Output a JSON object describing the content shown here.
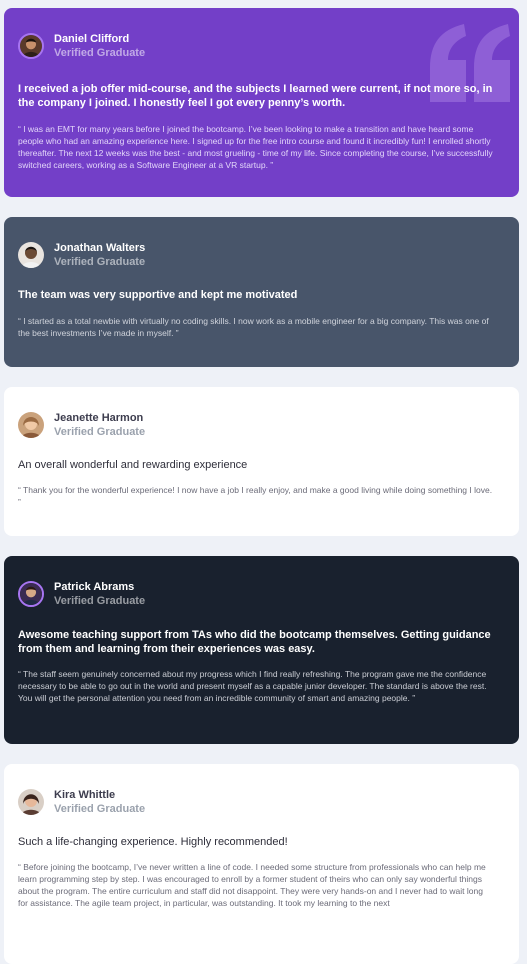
{
  "testimonials": [
    {
      "name": "Daniel Clifford",
      "role": "Verified Graduate",
      "headline": "I received a job offer mid-course, and the subjects I learned were current, if not more so, in the company I joined. I honestly feel I got every penny’s worth.",
      "quote": "“ I was an EMT for many years before I joined the bootcamp. I’ve been looking to make a transition and have heard some people who had an amazing experience here. I signed up for the free intro course and found it incredibly fun! I enrolled shortly thereafter. The next 12 weeks was the best - and most grueling - time of my life. Since completing the course, I’ve successfully switched careers, working as a Software Engineer at a VR startup. ”"
    },
    {
      "name": "Jonathan Walters",
      "role": "Verified Graduate",
      "headline": "The team was very supportive and kept me motivated",
      "quote": "“ I started as a total newbie with virtually no coding skills. I now work as a mobile engineer for a big company. This was one of the best investments I’ve made in myself. ”"
    },
    {
      "name": "Jeanette Harmon",
      "role": "Verified Graduate",
      "headline": "An overall wonderful and rewarding experience",
      "quote": "“ Thank you for the wonderful experience! I now have a job I really enjoy, and make a good living while doing something I love. ”"
    },
    {
      "name": "Patrick Abrams",
      "role": "Verified Graduate",
      "headline": "Awesome teaching support from TAs who did the bootcamp themselves. Getting guidance from them and learning from their experiences was easy.",
      "quote": "“ The staff seem genuinely concerned about my progress which I find really refreshing. The program gave me the confidence necessary to be able to go out in the world and present myself as a capable junior developer. The standard is above the rest. You will get the personal attention you need from an incredible community of smart and amazing people. ”"
    },
    {
      "name": "Kira Whittle",
      "role": "Verified Graduate",
      "headline": "Such a life-changing experience. Highly recommended!",
      "quote": "“ Before joining the bootcamp, I’ve never written a line of code. I needed some structure from professionals who can help me learn programming step by step. I was encouraged to enroll by a former student of theirs who can only say wonderful things about the program. The entire curriculum and staff did not disappoint. They were very hands-on and I never had to wait long for assistance. The agile team project, in particular, was outstanding. It took my learning to the next"
    }
  ],
  "colors": {
    "moderate_violet": "#733fc8",
    "grayish_blue": "#48556a",
    "very_dark_blackish_blue": "#19212e",
    "white": "#ffffff",
    "background": "#eef1f7"
  },
  "icons": [
    "quotation-mark-icon"
  ]
}
